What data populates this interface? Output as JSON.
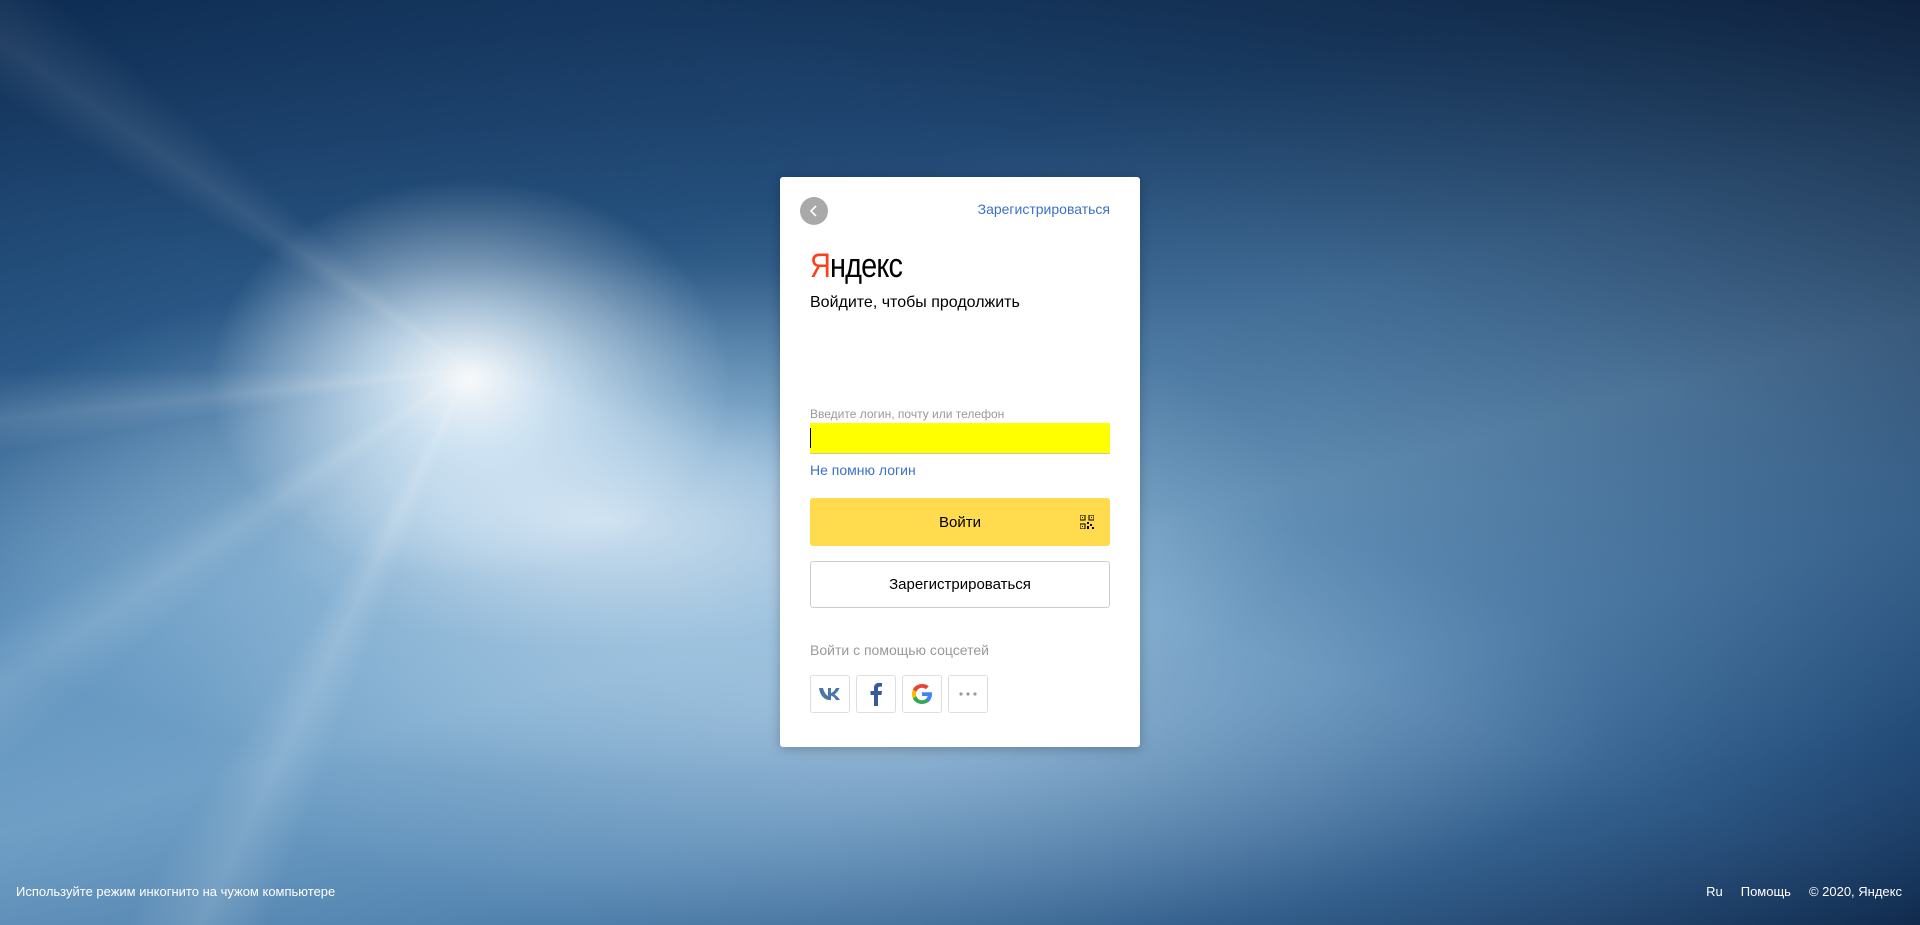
{
  "header": {
    "register_link": "Зарегистрироваться"
  },
  "logo": {
    "first_letter": "Я",
    "rest": "ндекс"
  },
  "form": {
    "subtitle": "Войдите, чтобы продолжить",
    "login_label": "Введите логин, почту или телефон",
    "login_value": "",
    "forgot_link": "Не помню логин",
    "login_button": "Войти",
    "register_button": "Зарегистрироваться",
    "social_title": "Войти с помощью соцсетей"
  },
  "social": [
    {
      "name": "vk-icon",
      "label": "VK"
    },
    {
      "name": "facebook-icon",
      "label": "f"
    },
    {
      "name": "google-icon",
      "label": "G"
    },
    {
      "name": "more-icon",
      "label": "···"
    }
  ],
  "footer": {
    "incognito_hint": "Используйте режим инкогнито на чужом компьютере",
    "lang": "Ru",
    "help": "Помощь",
    "copyright": "© 2020, Яндекс"
  },
  "colors": {
    "accent_yellow": "#ffdb4d",
    "link_blue": "#3b71c9",
    "logo_red": "#fc3f1d",
    "autofill_yellow": "#ffff00"
  }
}
